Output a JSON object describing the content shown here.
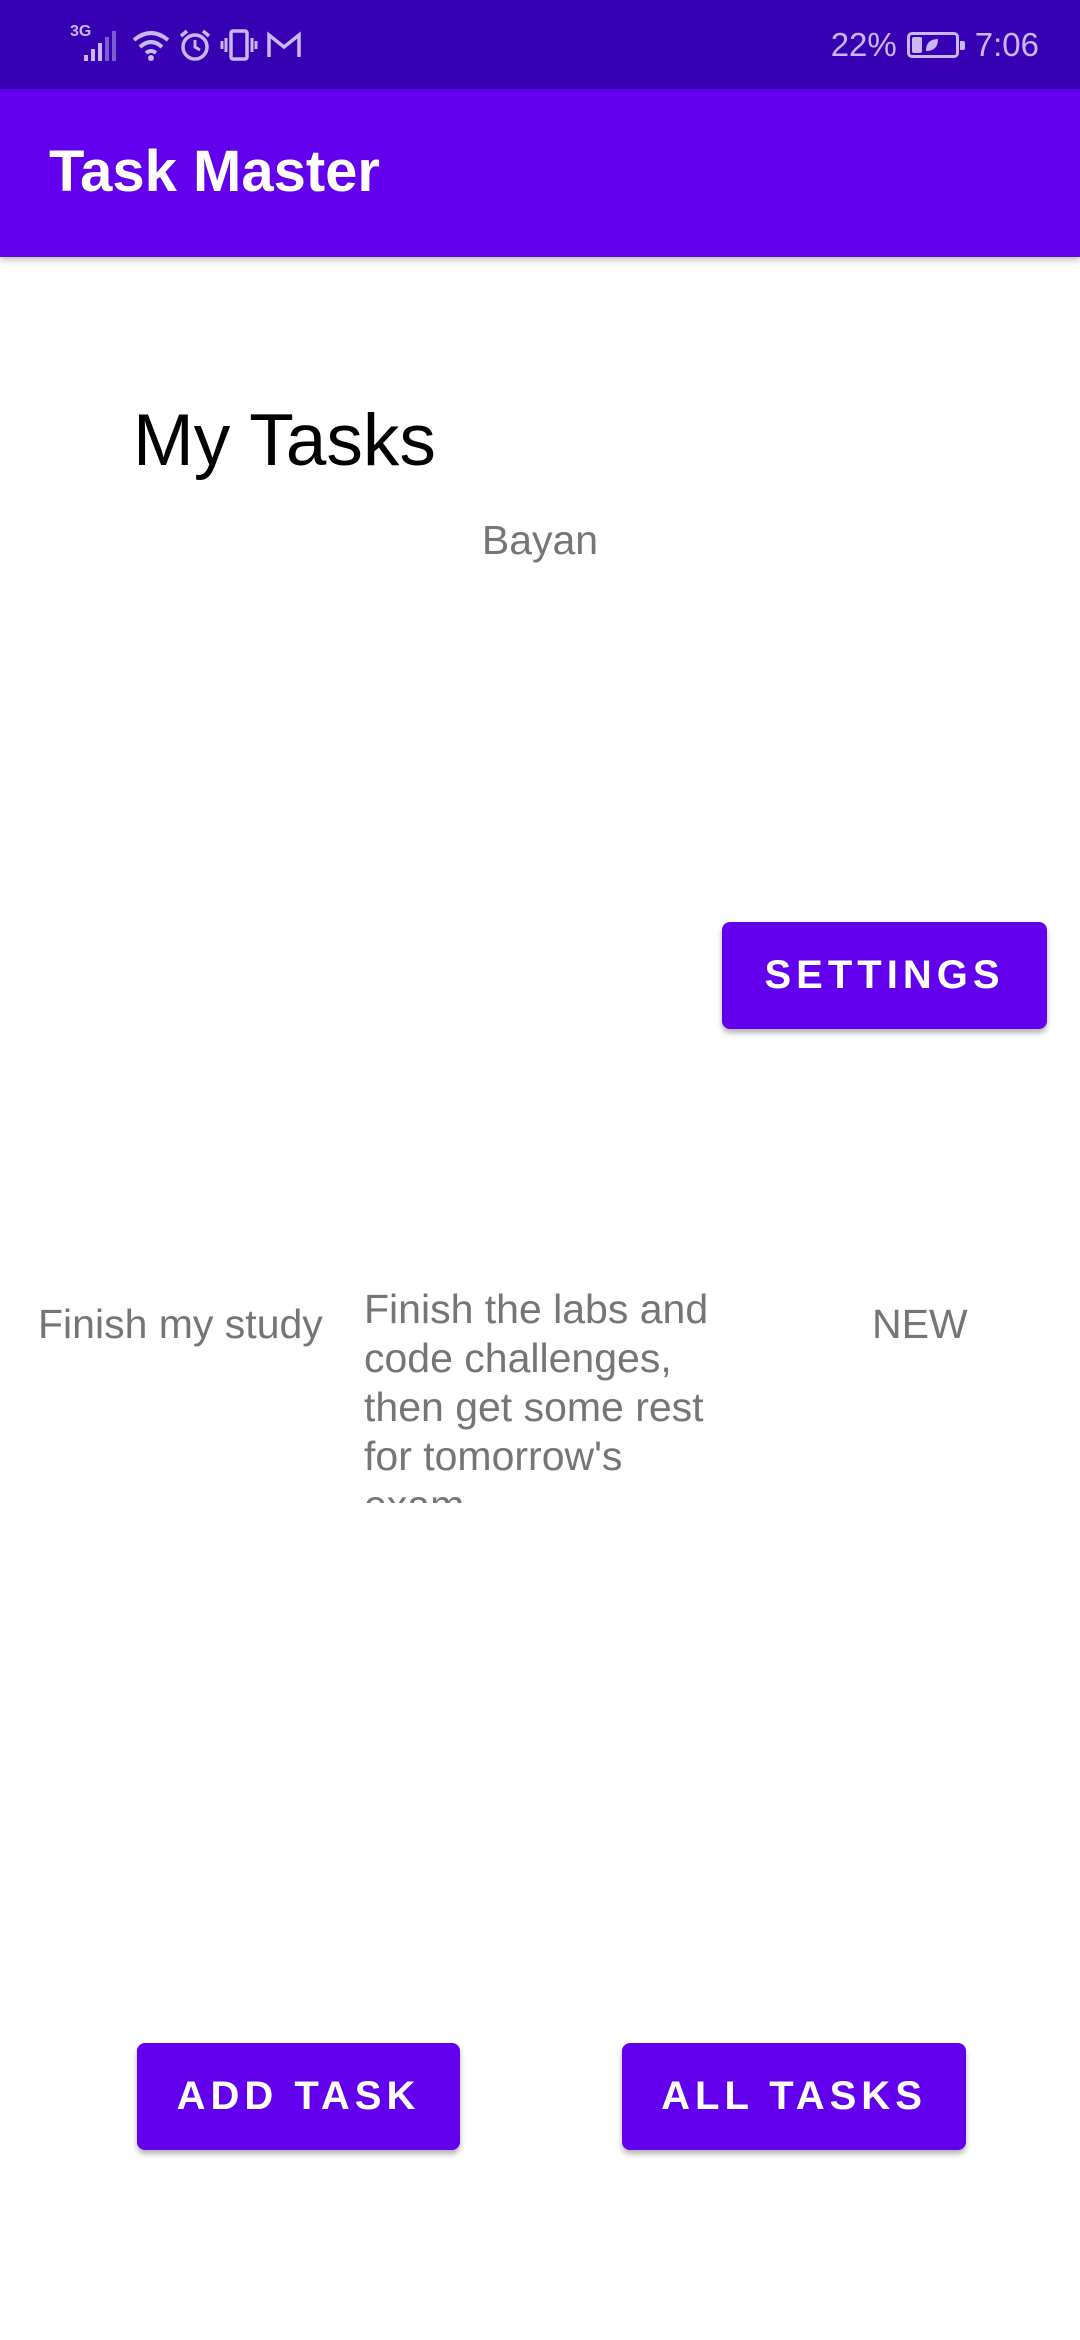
{
  "status_bar": {
    "network_type": "3G",
    "battery_level": "22%",
    "battery_fraction": 0.22,
    "time": "7:06",
    "icons": [
      "signal-icon",
      "wifi-icon",
      "alarm-icon",
      "vibrate-icon",
      "gmail-icon",
      "battery-icon"
    ]
  },
  "app_bar": {
    "title": "Task Master"
  },
  "main": {
    "heading": "My Tasks",
    "username": "Bayan",
    "settings_label": "SETTINGS"
  },
  "task": {
    "title": "Finish my study",
    "body": "Finish the labs and code challenges, then get some rest for tomorrow's exam",
    "state": "NEW"
  },
  "footer": {
    "add_task_label": "ADD TASK",
    "all_tasks_label": "ALL TASKS"
  },
  "colors": {
    "primary": "#6200ee",
    "primary_dark": "#3700b3",
    "secondary_text": "#757575"
  }
}
